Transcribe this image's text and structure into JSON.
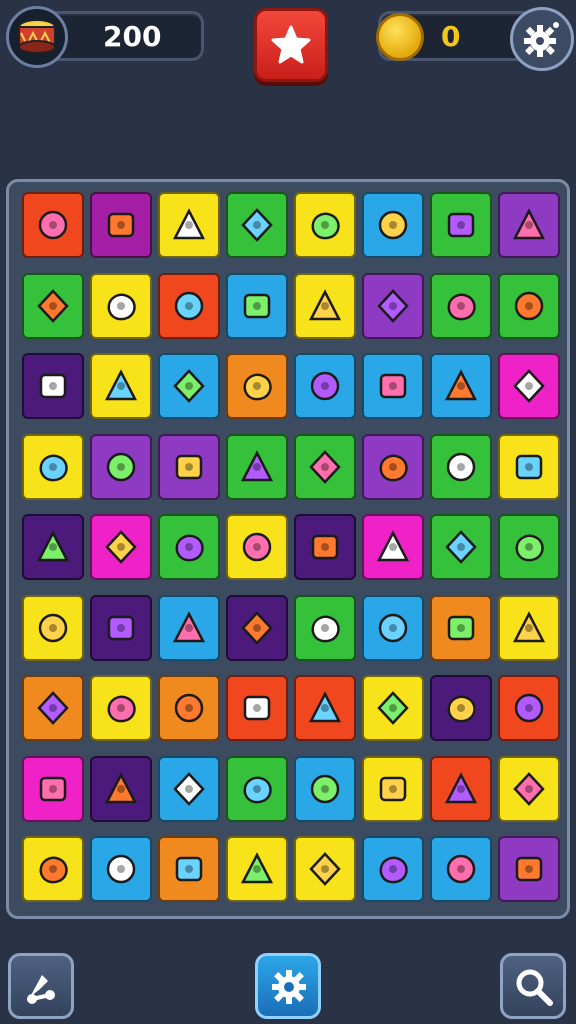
{
  "hud": {
    "score": "200",
    "coins": "0"
  },
  "colors": {
    "background": "#2a3346",
    "board": "#3d4b60",
    "coin_text": "#f5c518",
    "star_button": "#e8352b"
  },
  "board": {
    "columns": 8,
    "rows": 9,
    "tiles": [
      {
        "color": "#f0471f",
        "icon": "box-icon"
      },
      {
        "color": "#a41fa6",
        "icon": "crate-icon"
      },
      {
        "color": "#f8e21a",
        "icon": "jar-icon"
      },
      {
        "color": "#35c23a",
        "icon": "cupcake-icon"
      },
      {
        "color": "#f8e21a",
        "icon": "crayon-icon"
      },
      {
        "color": "#2aa7e6",
        "icon": "bowl-icon"
      },
      {
        "color": "#35c23a",
        "icon": "scroll-icon"
      },
      {
        "color": "#8e3ac2",
        "icon": "dish-icon"
      },
      {
        "color": "#35c23a",
        "icon": "cone-icon"
      },
      {
        "color": "#f8e21a",
        "icon": "cake-icon"
      },
      {
        "color": "#f0471f",
        "icon": "starfish-icon"
      },
      {
        "color": "#2aa7e6",
        "icon": "gear-icon"
      },
      {
        "color": "#f8e21a",
        "icon": "frame-icon"
      },
      {
        "color": "#8e3ac2",
        "icon": "log-icon"
      },
      {
        "color": "#35c23a",
        "icon": "bell-icon"
      },
      {
        "color": "#35c23a",
        "icon": "sun-icon"
      },
      {
        "color": "#4b1a7a",
        "icon": "flower-icon"
      },
      {
        "color": "#f8e21a",
        "icon": "calendar-icon"
      },
      {
        "color": "#2aa7e6",
        "icon": "pencil-icon"
      },
      {
        "color": "#f08a1e",
        "icon": "radio-icon"
      },
      {
        "color": "#2aa7e6",
        "icon": "bottle-icon"
      },
      {
        "color": "#2aa7e6",
        "icon": "sun-icon"
      },
      {
        "color": "#2aa7e6",
        "icon": "flask-icon"
      },
      {
        "color": "#ee22c6",
        "icon": "dish-icon"
      },
      {
        "color": "#f8e21a",
        "icon": "brush-icon"
      },
      {
        "color": "#8e3ac2",
        "icon": "heart-icon"
      },
      {
        "color": "#8e3ac2",
        "icon": "camera-icon"
      },
      {
        "color": "#35c23a",
        "icon": "cylinder-icon"
      },
      {
        "color": "#35c23a",
        "icon": "note-icon"
      },
      {
        "color": "#8e3ac2",
        "icon": "screen-icon"
      },
      {
        "color": "#35c23a",
        "icon": "cup-icon"
      },
      {
        "color": "#f8e21a",
        "icon": "sun-icon"
      },
      {
        "color": "#4b1a7a",
        "icon": "tree-icon"
      },
      {
        "color": "#ee22c6",
        "icon": "saucer-icon"
      },
      {
        "color": "#35c23a",
        "icon": "picture-icon"
      },
      {
        "color": "#f8e21a",
        "icon": "ring-icon"
      },
      {
        "color": "#4b1a7a",
        "icon": "cherry-icon"
      },
      {
        "color": "#ee22c6",
        "icon": "grid-icon"
      },
      {
        "color": "#35c23a",
        "icon": "stone-icon"
      },
      {
        "color": "#35c23a",
        "icon": "creature-icon"
      },
      {
        "color": "#f8e21a",
        "icon": "shell-icon"
      },
      {
        "color": "#4b1a7a",
        "icon": "phone-icon"
      },
      {
        "color": "#2aa7e6",
        "icon": "leaf-icon"
      },
      {
        "color": "#4b1a7a",
        "icon": "horn-icon"
      },
      {
        "color": "#35c23a",
        "icon": "sign-icon"
      },
      {
        "color": "#2aa7e6",
        "icon": "sprout-icon"
      },
      {
        "color": "#f08a1e",
        "icon": "burst-icon"
      },
      {
        "color": "#f8e21a",
        "icon": "beads-icon"
      },
      {
        "color": "#f08a1e",
        "icon": "icecream-icon"
      },
      {
        "color": "#f8e21a",
        "icon": "plate-icon"
      },
      {
        "color": "#f08a1e",
        "icon": "flame-icon"
      },
      {
        "color": "#f0471f",
        "icon": "ornament-icon"
      },
      {
        "color": "#f0471f",
        "icon": "card-icon"
      },
      {
        "color": "#f8e21a",
        "icon": "leaves-icon"
      },
      {
        "color": "#4b1a7a",
        "icon": "marker-icon"
      },
      {
        "color": "#f0471f",
        "icon": "sticker-icon"
      },
      {
        "color": "#ee22c6",
        "icon": "lamp-icon"
      },
      {
        "color": "#4b1a7a",
        "icon": "flag-icon"
      },
      {
        "color": "#2aa7e6",
        "icon": "mask-icon"
      },
      {
        "color": "#35c23a",
        "icon": "wedge-icon"
      },
      {
        "color": "#2aa7e6",
        "icon": "tube-icon"
      },
      {
        "color": "#f8e21a",
        "icon": "package-icon"
      },
      {
        "color": "#f0471f",
        "icon": "crossed-sticks-icon"
      },
      {
        "color": "#f8e21a",
        "icon": "cloud-icon"
      },
      {
        "color": "#f8e21a",
        "icon": "tomato-icon"
      },
      {
        "color": "#2aa7e6",
        "icon": "cog-icon"
      },
      {
        "color": "#f08a1e",
        "icon": "mushroom-icon"
      },
      {
        "color": "#f8e21a",
        "icon": "splat-icon"
      },
      {
        "color": "#f8e21a",
        "icon": "tablet-icon"
      },
      {
        "color": "#2aa7e6",
        "icon": "seed-icon"
      },
      {
        "color": "#2aa7e6",
        "icon": "can-icon"
      },
      {
        "color": "#8e3ac2",
        "icon": "packet-icon"
      }
    ]
  }
}
